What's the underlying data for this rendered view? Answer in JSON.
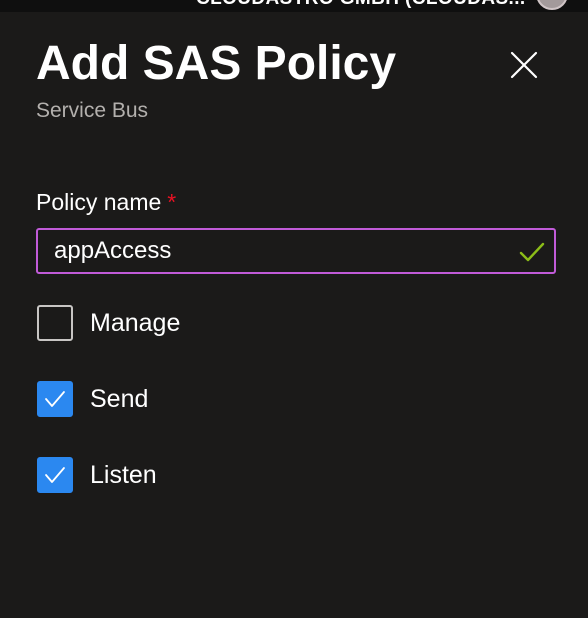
{
  "topbar": {
    "account_text": "CLOUDASTRO GMBH (CLOUDAS..."
  },
  "panel": {
    "title": "Add SAS Policy",
    "subtitle": "Service Bus"
  },
  "policy_name": {
    "label": "Policy name",
    "required_marker": "*",
    "value": "appAccess",
    "valid": true
  },
  "permissions": [
    {
      "label": "Manage",
      "checked": false
    },
    {
      "label": "Send",
      "checked": true
    },
    {
      "label": "Listen",
      "checked": true
    }
  ],
  "colors": {
    "background": "#1b1a19",
    "input_border_focus": "#c15bd8",
    "checkbox_checked": "#2b88f0",
    "valid_check": "#8cbd18",
    "required": "#e81123"
  },
  "icons": {
    "close": "close-icon",
    "valid": "checkmark-icon",
    "checkbox_check": "checkmark-icon"
  }
}
